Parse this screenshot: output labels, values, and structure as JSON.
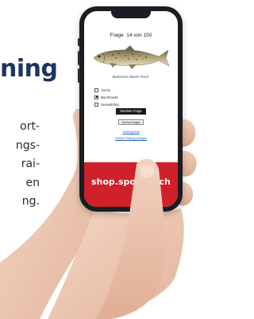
{
  "article": {
    "headline_fragment": "ning",
    "body_fragments": [
      "ort-",
      "ngs-",
      "rai-",
      "en",
      "ng."
    ]
  },
  "phone": {
    "quiz": {
      "counter": "Frage: 14 von 150",
      "question": "Bestimme diesen Fisch.",
      "options": [
        {
          "label": "Äsche",
          "checked": false
        },
        {
          "label": "Bachforelle",
          "checked": true
        },
        {
          "label": "Seesaibling",
          "checked": false
        }
      ],
      "next_button": "Nächste Frage",
      "lookup_button": "Nachschlagen",
      "link_overview": "Testergebnis",
      "link_suggest": "Online-Prüfung ablegen"
    },
    "banner": {
      "text": "shop.sportf",
      "suffix": "ch"
    }
  },
  "colors": {
    "headline": "#1b3563",
    "banner": "#d0202a",
    "phone_frame": "#1a1d22",
    "link": "#1a5fb4"
  }
}
